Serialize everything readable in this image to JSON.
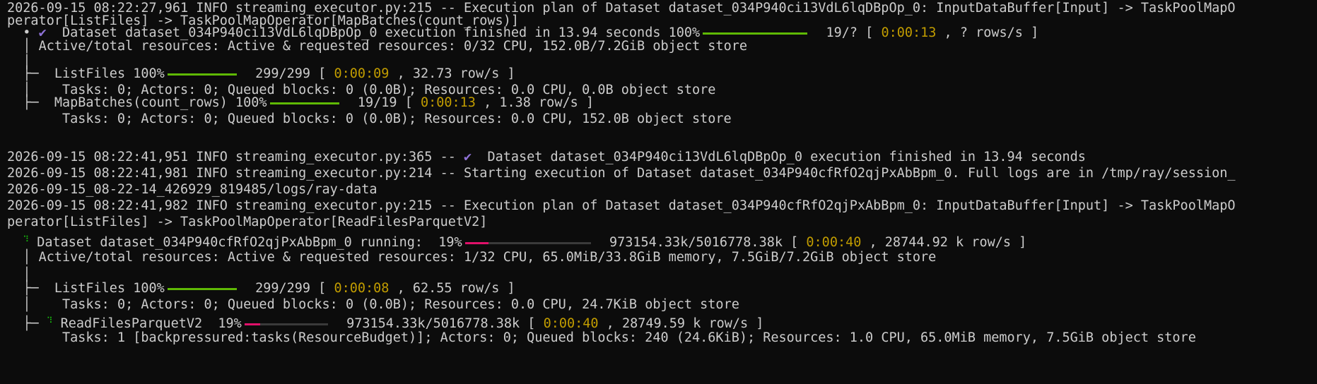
{
  "colors": {
    "background": "#0c0c0c",
    "text": "#cccccc",
    "time_highlight": "#c19c00",
    "done_bar": "#5fb905",
    "running_bar": "#e0116a",
    "check": "#8f72d8",
    "spinner": "#16c60c"
  },
  "icons": {
    "bullet": "•",
    "check": "✔",
    "spinner": "⠹",
    "tree": "├─",
    "pipe": "│"
  },
  "lines": {
    "l1": "2026-09-15 08:22:27,961 INFO streaming_executor.py:215 -- Execution plan of Dataset dataset_034P940ci13VdL6lqDBpOp_0: InputDataBuffer[Input] -> TaskPoolMapO",
    "l2": "perator[ListFiles] -> TaskPoolMapOperator[MapBatches(count_rows)]",
    "l3": {
      "label": "Dataset dataset_034P940ci13VdL6lqDBpOp_0 execution finished in 13.94 seconds 100%",
      "progress": 1.0,
      "count": "19/?",
      "elapsed": "0:00:13",
      "rate": ", ? rows/s ]"
    },
    "l4": "Active/total resources: Active & requested resources: 0/32 CPU, 152.0B/7.2GiB object store",
    "l6": {
      "label": "ListFiles 100%",
      "progress": 1.0,
      "count": "299/299 [",
      "elapsed": "0:00:09",
      "rate": ", 32.73 row/s ]"
    },
    "l7": "Tasks: 0; Actors: 0; Queued blocks: 0 (0.0B); Resources: 0.0 CPU, 0.0B object store",
    "l8": {
      "label": "MapBatches(count_rows) 100%",
      "progress": 1.0,
      "count": "19/19 [",
      "elapsed": "0:00:13",
      "rate": ", 1.38 row/s ]"
    },
    "l9": "Tasks: 0; Actors: 0; Queued blocks: 0 (0.0B); Resources: 0.0 CPU, 152.0B object store",
    "l11": {
      "prefix": "2026-09-15 08:22:41,951 INFO streaming_executor.py:365 --",
      "text": "Dataset dataset_034P940ci13VdL6lqDBpOp_0 execution finished in 13.94 seconds"
    },
    "l12": "2026-09-15 08:22:41,981 INFO streaming_executor.py:214 -- Starting execution of Dataset dataset_034P940cfRfO2qjPxAbBpm_0. Full logs are in /tmp/ray/session_",
    "l13": "2026-09-15_08-22-14_426929_819485/logs/ray-data",
    "l14": "2026-09-15 08:22:41,982 INFO streaming_executor.py:215 -- Execution plan of Dataset dataset_034P940cfRfO2qjPxAbBpm_0: InputDataBuffer[Input] -> TaskPoolMapO",
    "l15": "perator[ListFiles] -> TaskPoolMapOperator[ReadFilesParquetV2]",
    "l16": {
      "label": "Dataset dataset_034P940cfRfO2qjPxAbBpm_0 running:  19%",
      "progress": 0.19,
      "count": "973154.33k/5016778.38k [",
      "elapsed": "0:00:40",
      "rate": ", 28744.92 k row/s ]"
    },
    "l17": "Active/total resources: Active & requested resources: 1/32 CPU, 65.0MiB/33.8GiB memory, 7.5GiB/7.2GiB object store",
    "l19": {
      "label": "ListFiles 100%",
      "progress": 1.0,
      "count": "299/299 [",
      "elapsed": "0:00:08",
      "rate": ", 62.55 row/s ]"
    },
    "l20": "Tasks: 0; Actors: 0; Queued blocks: 0 (0.0B); Resources: 0.0 CPU, 24.7KiB object store",
    "l21": {
      "label": "ReadFilesParquetV2  19%",
      "progress": 0.19,
      "count": "973154.33k/5016778.38k [",
      "elapsed": "0:00:40",
      "rate": ", 28749.59 k row/s ]"
    },
    "l22": "Tasks: 1 [backpressured:tasks(ResourceBudget)]; Actors: 0; Queued blocks: 240 (24.6KiB); Resources: 1.0 CPU, 65.0MiB memory, 7.5GiB object store"
  }
}
